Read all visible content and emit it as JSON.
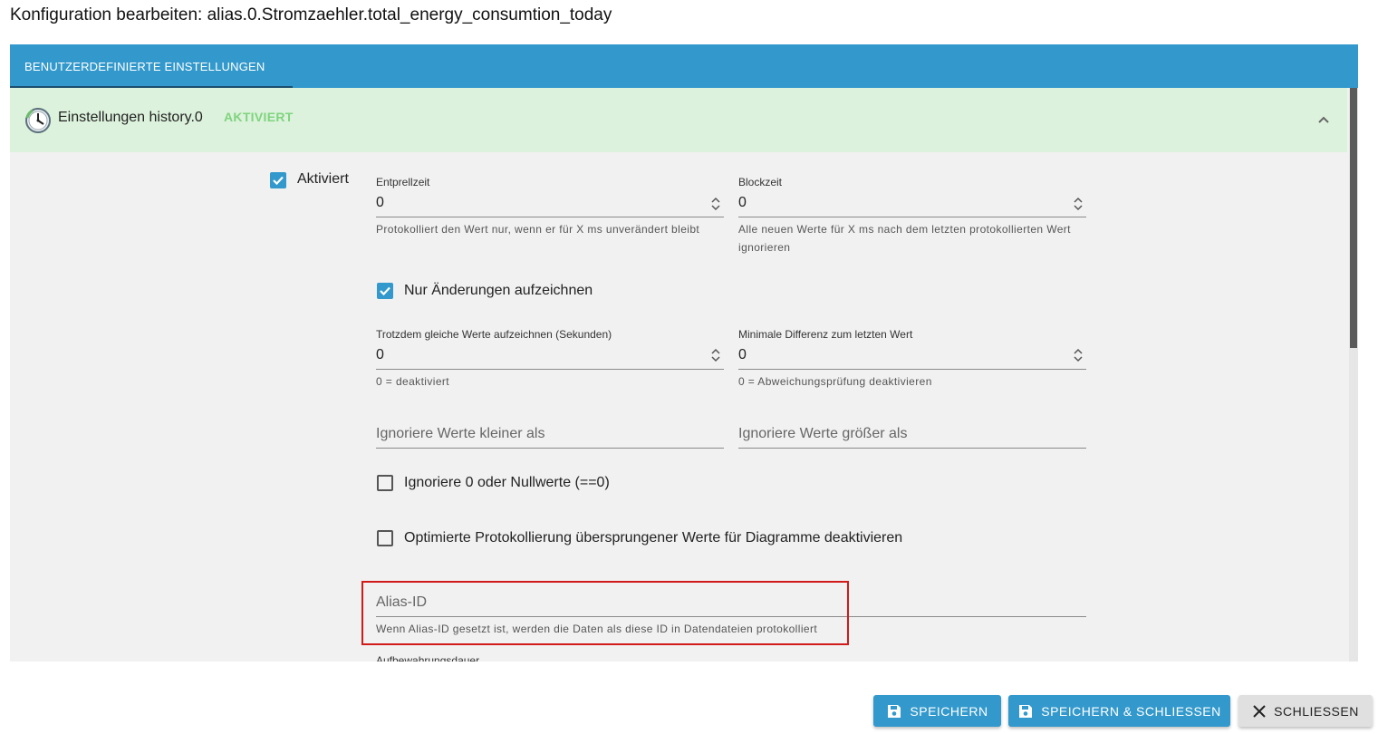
{
  "dialog": {
    "title": "Konfiguration bearbeiten: alias.0.Stromzaehler.total_energy_consumtion_today"
  },
  "tabs": [
    {
      "label": "BENUTZERDEFINIERTE EINSTELLUNGEN"
    }
  ],
  "panel": {
    "title": "Einstellungen history.0",
    "status": "AKTIVIERT",
    "icon": "history-adapter-icon",
    "status_color": "#7fd47f"
  },
  "form": {
    "enabled": {
      "label": "Aktiviert",
      "checked": true
    },
    "debounce": {
      "label": "Entprellzeit",
      "value": "0",
      "helper": "Protokolliert den Wert nur, wenn er für X ms unverändert bleibt"
    },
    "blocktime": {
      "label": "Blockzeit",
      "value": "0",
      "helper": "Alle neuen Werte für X ms nach dem letzten protokollierten Wert ignorieren"
    },
    "changes_only": {
      "label": "Nur Änderungen aufzeichnen",
      "checked": true
    },
    "changes_relog": {
      "label": "Trotzdem gleiche Werte aufzeichnen (Sekunden)",
      "value": "0",
      "helper": "0 = deaktiviert"
    },
    "changes_min_delta": {
      "label": "Minimale Differenz zum letzten Wert",
      "value": "0",
      "helper": "0 = Abweichungsprüfung deaktivieren"
    },
    "ignore_below": {
      "placeholder": "Ignoriere Werte kleiner als"
    },
    "ignore_above": {
      "placeholder": "Ignoriere Werte größer als"
    },
    "ignore_zero": {
      "label": "Ignoriere 0 oder Nullwerte (==0)",
      "checked": false
    },
    "disable_skipped": {
      "label": "Optimierte Protokollierung übersprungener Werte für Diagramme deaktivieren",
      "checked": false
    },
    "alias_id": {
      "placeholder": "Alias-ID",
      "helper": "Wenn Alias-ID gesetzt ist, werden die Daten als diese ID in Datendateien protokolliert"
    },
    "retention": {
      "label": "Aufbewahrungsdauer"
    }
  },
  "buttons": {
    "save": "SPEICHERN",
    "save_close": "SPEICHERN & SCHLIESSEN",
    "close": "SCHLIESSEN"
  },
  "colors": {
    "accent": "#3399cc",
    "highlight": "#d11a1a",
    "panel_bg": "#dcf2dc"
  }
}
